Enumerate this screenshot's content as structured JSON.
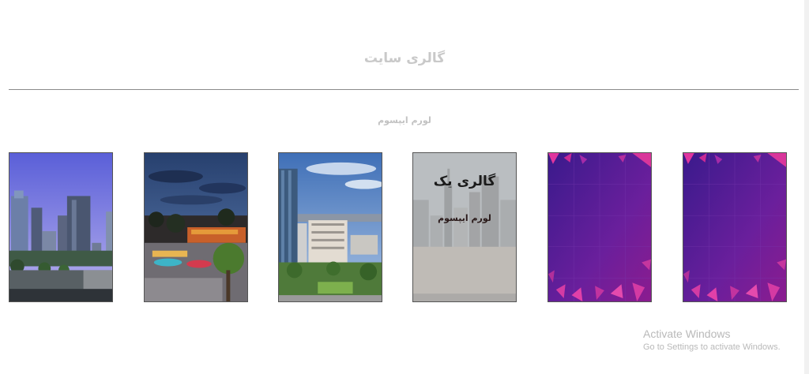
{
  "header": {
    "title": "گالری سایت"
  },
  "gallery": {
    "subtitle": "لورم ایپسوم",
    "overlay": {
      "title": "گالری یک",
      "text": "لورم ایپسوم"
    },
    "cards": [
      {
        "image": "city-skyline-photo"
      },
      {
        "image": "plaza-at-dusk-photo"
      },
      {
        "image": "office-park-photo"
      },
      {
        "image": "city-grey-photo"
      },
      {
        "image": "purple-geometric-pattern"
      },
      {
        "image": "purple-geometric-pattern"
      }
    ]
  },
  "watermark": {
    "title": "Activate Windows",
    "subtitle": "Go to Settings to activate Windows."
  }
}
